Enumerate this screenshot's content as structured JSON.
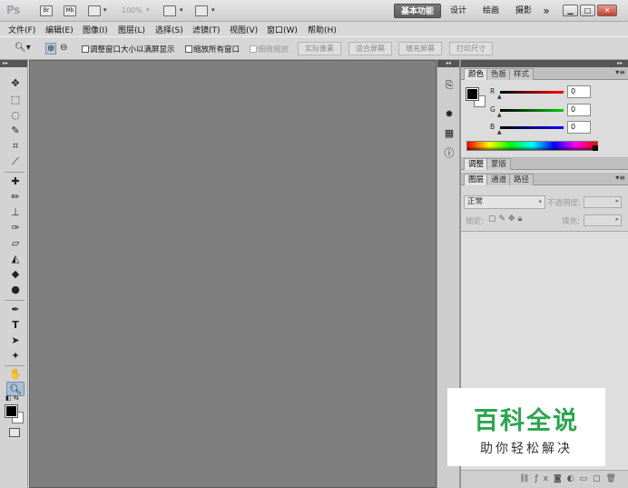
{
  "app": {
    "logo": "Ps"
  },
  "appbar": {
    "br_label": "Br",
    "mb_label": "Mb",
    "zoom_level": "100%",
    "workspaces": [
      "基本功能",
      "设计",
      "绘画",
      "摄影"
    ],
    "more": "»",
    "window_controls": [
      "▁",
      "□",
      "✕"
    ]
  },
  "menubar": {
    "items": [
      "文件(F)",
      "编辑(E)",
      "图像(I)",
      "图层(L)",
      "选择(S)",
      "滤镜(T)",
      "视图(V)",
      "窗口(W)",
      "帮助(H)"
    ]
  },
  "options": {
    "resize_windows": "调整窗口大小以满屏显示",
    "zoom_all": "缩放所有窗口",
    "scrubby_zoom": "细微缩放",
    "buttons": [
      "实际像素",
      "适合屏幕",
      "填充屏幕",
      "打印尺寸"
    ]
  },
  "panels": {
    "color_tabs": [
      "颜色",
      "色板",
      "样式"
    ],
    "channels": {
      "r": "R",
      "g": "G",
      "b": "B"
    },
    "values": {
      "r": "0",
      "g": "0",
      "b": "0"
    },
    "adjust_tabs": [
      "调整",
      "蒙版"
    ],
    "layer_tabs": [
      "图层",
      "通道",
      "路径"
    ],
    "blend_mode": "正常",
    "opacity_label": "不透明度:",
    "lock_label": "锁定:",
    "fill_label": "填充:"
  },
  "colors": {
    "canvas_bg": "#7f7f7f",
    "accent_green": "#2aa64e",
    "workspace_active": "#5e5e5e"
  },
  "watermark": {
    "title": "百科全说",
    "subtitle": "助你轻松解决"
  }
}
